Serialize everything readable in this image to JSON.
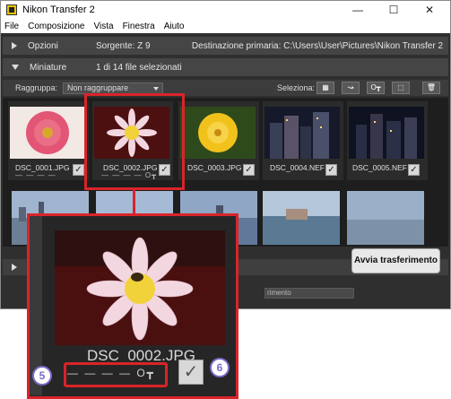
{
  "window": {
    "title": "Nikon Transfer 2",
    "controls": {
      "minimize": "—",
      "maximize": "☐",
      "close": "✕"
    }
  },
  "menu": [
    "File",
    "Composizione",
    "Vista",
    "Finestra",
    "Aiuto"
  ],
  "options_bar": {
    "label": "Opzioni",
    "source": "Sorgente: Z 9",
    "destination": "Destinazione primaria: C:\\Users\\User\\Pictures\\Nikon Transfer 2"
  },
  "thumbnails_bar": {
    "label": "Miniature",
    "selection_count": "1 di 14 file selezionati"
  },
  "group_bar": {
    "label": "Raggruppa:",
    "group_value": "Non raggruppare",
    "select_label": "Seleziona:"
  },
  "thumbnails": [
    {
      "name": "DSC_0001.JPG",
      "checked": true,
      "selected": false
    },
    {
      "name": "DSC_0002.JPG",
      "checked": true,
      "selected": true
    },
    {
      "name": "DSC_0003.JPG",
      "checked": true,
      "selected": false
    },
    {
      "name": "DSC_0004.NEF",
      "checked": true,
      "selected": false
    },
    {
      "name": "DSC_0005.NEF",
      "checked": true,
      "selected": false
    }
  ],
  "progress": {
    "text": "rimento"
  },
  "start_button": {
    "label": "Avvia trasferimento"
  },
  "zoom": {
    "name": "DSC_0002.JPG",
    "dash_text": "— — — — O┳",
    "badge_left": "5",
    "badge_right": "6"
  },
  "colors": {
    "callout": "#d9242a",
    "badge": "#7b68c8"
  }
}
